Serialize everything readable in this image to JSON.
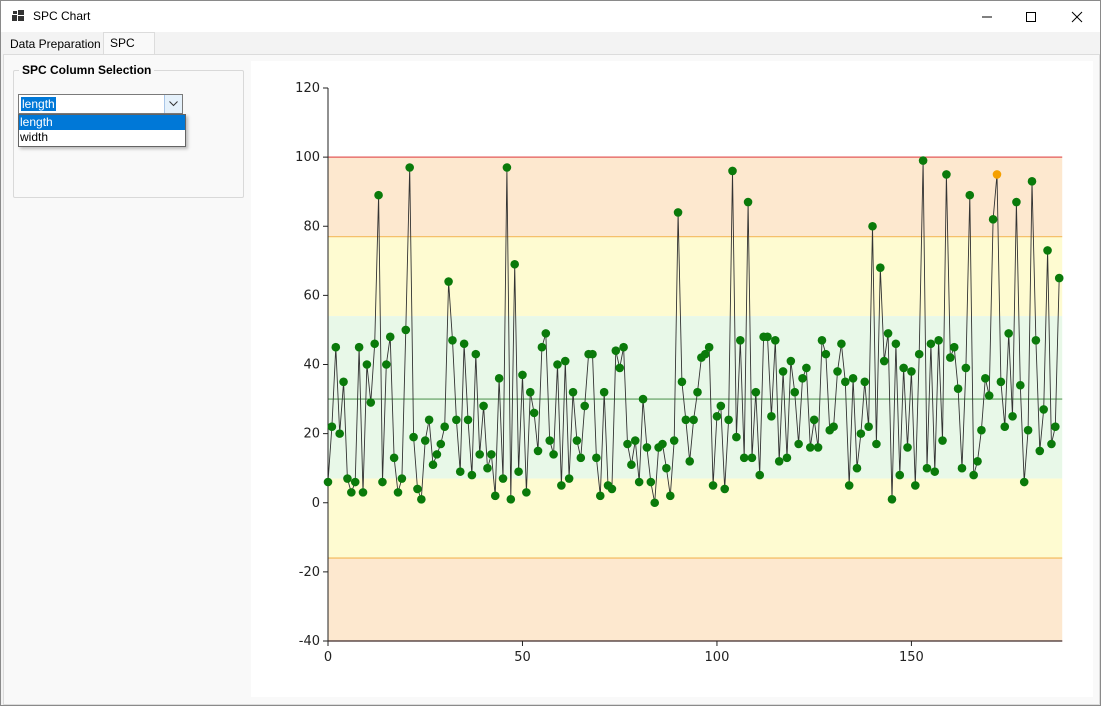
{
  "window": {
    "title": "SPC Chart"
  },
  "tabs": [
    {
      "label": "Data Preparation"
    },
    {
      "label": "SPC"
    }
  ],
  "group": {
    "title": "SPC Column Selection",
    "combo_value": "length",
    "options": [
      "length",
      "width"
    ]
  },
  "chart_data": {
    "type": "line",
    "xlim": [
      0,
      190
    ],
    "ylim": [
      -40,
      120
    ],
    "x_ticks": [
      0,
      50,
      100,
      150
    ],
    "y_ticks": [
      120,
      100,
      80,
      60,
      40,
      20,
      0,
      -20,
      -40
    ],
    "bands": [
      {
        "from": 77,
        "to": 100,
        "color": "#fde8cf"
      },
      {
        "from": 54,
        "to": 77,
        "color": "#fefbd1"
      },
      {
        "from": 7,
        "to": 54,
        "color": "#e8f8e8"
      },
      {
        "from": -16,
        "to": 7,
        "color": "#fefbd1"
      },
      {
        "from": -40,
        "to": -16,
        "color": "#fde8cf"
      }
    ],
    "limit_lines": [
      {
        "y": 100,
        "color": "#e35a5a"
      },
      {
        "y": 77,
        "color": "#f5c06b"
      },
      {
        "y": -16,
        "color": "#f5c06b"
      },
      {
        "y": -40,
        "color": "#b34a4a"
      }
    ],
    "center_line": {
      "y": 30,
      "color": "#5a9a5a"
    },
    "point_color": "#0a7a0a",
    "highlight_color": "#f5a000",
    "highlight_index": 172,
    "y": [
      6,
      22,
      45,
      20,
      35,
      7,
      3,
      6,
      45,
      3,
      40,
      29,
      46,
      89,
      6,
      40,
      48,
      13,
      3,
      7,
      50,
      97,
      19,
      4,
      1,
      18,
      24,
      11,
      14,
      17,
      22,
      64,
      47,
      24,
      9,
      46,
      24,
      8,
      43,
      14,
      28,
      10,
      14,
      2,
      36,
      7,
      97,
      1,
      69,
      9,
      37,
      3,
      32,
      26,
      15,
      45,
      49,
      18,
      14,
      40,
      5,
      41,
      7,
      32,
      18,
      13,
      28,
      43,
      43,
      13,
      2,
      32,
      5,
      4,
      44,
      39,
      45,
      17,
      11,
      18,
      6,
      30,
      16,
      6,
      0,
      16,
      17,
      10,
      2,
      18,
      84,
      35,
      24,
      12,
      24,
      32,
      42,
      43,
      45,
      5,
      25,
      28,
      4,
      24,
      96,
      19,
      47,
      13,
      87,
      13,
      32,
      8,
      48,
      48,
      25,
      47,
      12,
      38,
      13,
      41,
      32,
      17,
      36,
      39,
      16,
      24,
      16,
      47,
      43,
      21,
      22,
      38,
      46,
      35,
      5,
      36,
      10,
      20,
      35,
      22,
      80,
      17,
      68,
      41,
      49,
      1,
      46,
      8,
      39,
      16,
      38,
      5,
      43,
      99,
      10,
      46,
      9,
      47,
      18,
      95,
      42,
      45,
      33,
      10,
      39,
      89,
      8,
      12,
      21,
      36,
      31,
      82,
      95,
      35,
      22,
      49,
      25,
      87,
      34,
      6,
      21,
      93,
      47,
      15,
      27,
      73,
      17,
      22,
      65
    ]
  }
}
